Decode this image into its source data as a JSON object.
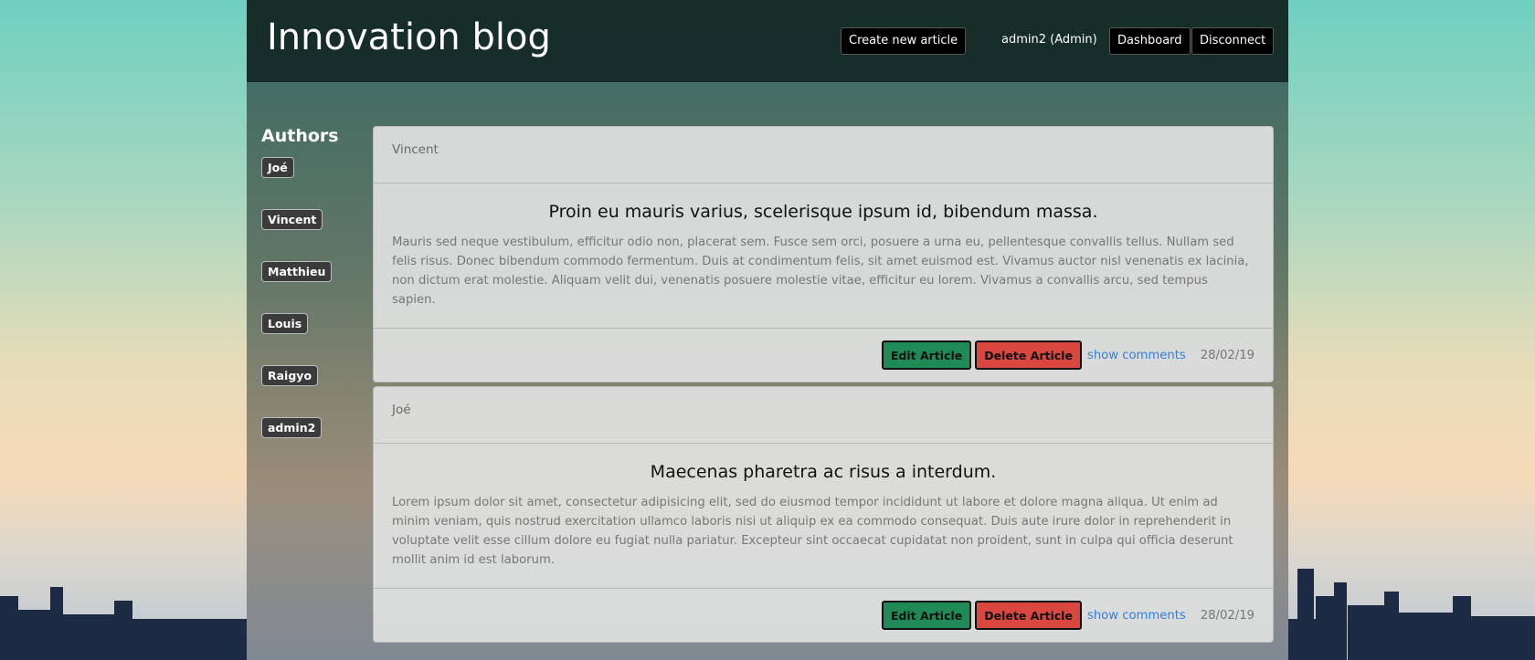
{
  "header": {
    "brand": "Innovation blog",
    "create_label": "Create new article",
    "user_label": "admin2 (Admin)",
    "dashboard_label": "Dashboard",
    "disconnect_label": "Disconnect"
  },
  "sidebar": {
    "title": "Authors",
    "authors": [
      "Joé",
      "Vincent",
      "Matthieu",
      "Louis",
      "Raigyo",
      "admin2"
    ]
  },
  "articles": [
    {
      "author": "Vincent",
      "title": "Proin eu mauris varius, scelerisque ipsum id, bibendum massa.",
      "body": "Mauris sed neque vestibulum, efficitur odio non, placerat sem. Fusce sem orci, posuere a urna eu, pellentesque convallis tellus. Nullam sed felis risus. Donec bibendum commodo fermentum. Duis at condimentum felis, sit amet euismod est. Vivamus auctor nisl venenatis ex lacinia, non dictum erat molestie. Aliquam velit dui, venenatis posuere molestie vitae, efficitur eu lorem. Vivamus a convallis arcu, sed tempus sapien.",
      "edit_label": "Edit Article",
      "delete_label": "Delete Article",
      "comments_label": "show comments",
      "date": "28/02/19"
    },
    {
      "author": "Joé",
      "title": "Maecenas pharetra ac risus a interdum.",
      "body": "Lorem ipsum dolor sit amet, consectetur adipisicing elit, sed do eiusmod tempor incididunt ut labore et dolore magna aliqua. Ut enim ad minim veniam, quis nostrud exercitation ullamco laboris nisi ut aliquip ex ea commodo consequat. Duis aute irure dolor in reprehenderit in voluptate velit esse cillum dolore eu fugiat nulla pariatur. Excepteur sint occaecat cupidatat non proident, sunt in culpa qui officia deserunt mollit anim id est laborum.",
      "edit_label": "Edit Article",
      "delete_label": "Delete Article",
      "comments_label": "show comments",
      "date": "28/02/19"
    }
  ]
}
